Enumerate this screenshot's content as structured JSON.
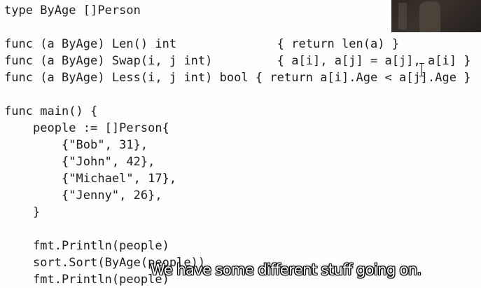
{
  "code_lines": [
    "type ByAge []Person",
    "",
    "func (a ByAge) Len() int              { return len(a) }",
    "func (a ByAge) Swap(i, j int)         { a[i], a[j] = a[j], a[i] }",
    "func (a ByAge) Less(i, j int) bool { return a[i].Age < a[j].Age }",
    "",
    "func main() {",
    "    people := []Person{",
    "        {\"Bob\", 31},",
    "        {\"John\", 42},",
    "        {\"Michael\", 17},",
    "        {\"Jenny\", 26},",
    "    }",
    "",
    "    fmt.Println(people)",
    "    sort.Sort(ByAge(people))",
    "    fmt.Println(people)"
  ],
  "subtitle": "We have some different stuff going on.",
  "colors": {
    "background": "#fefefe",
    "code_text": "#1d1d1d",
    "subtitle_text": "#ffffff",
    "subtitle_outline": "#000000"
  },
  "icons": {
    "text_cursor": "i-beam-cursor-icon"
  }
}
